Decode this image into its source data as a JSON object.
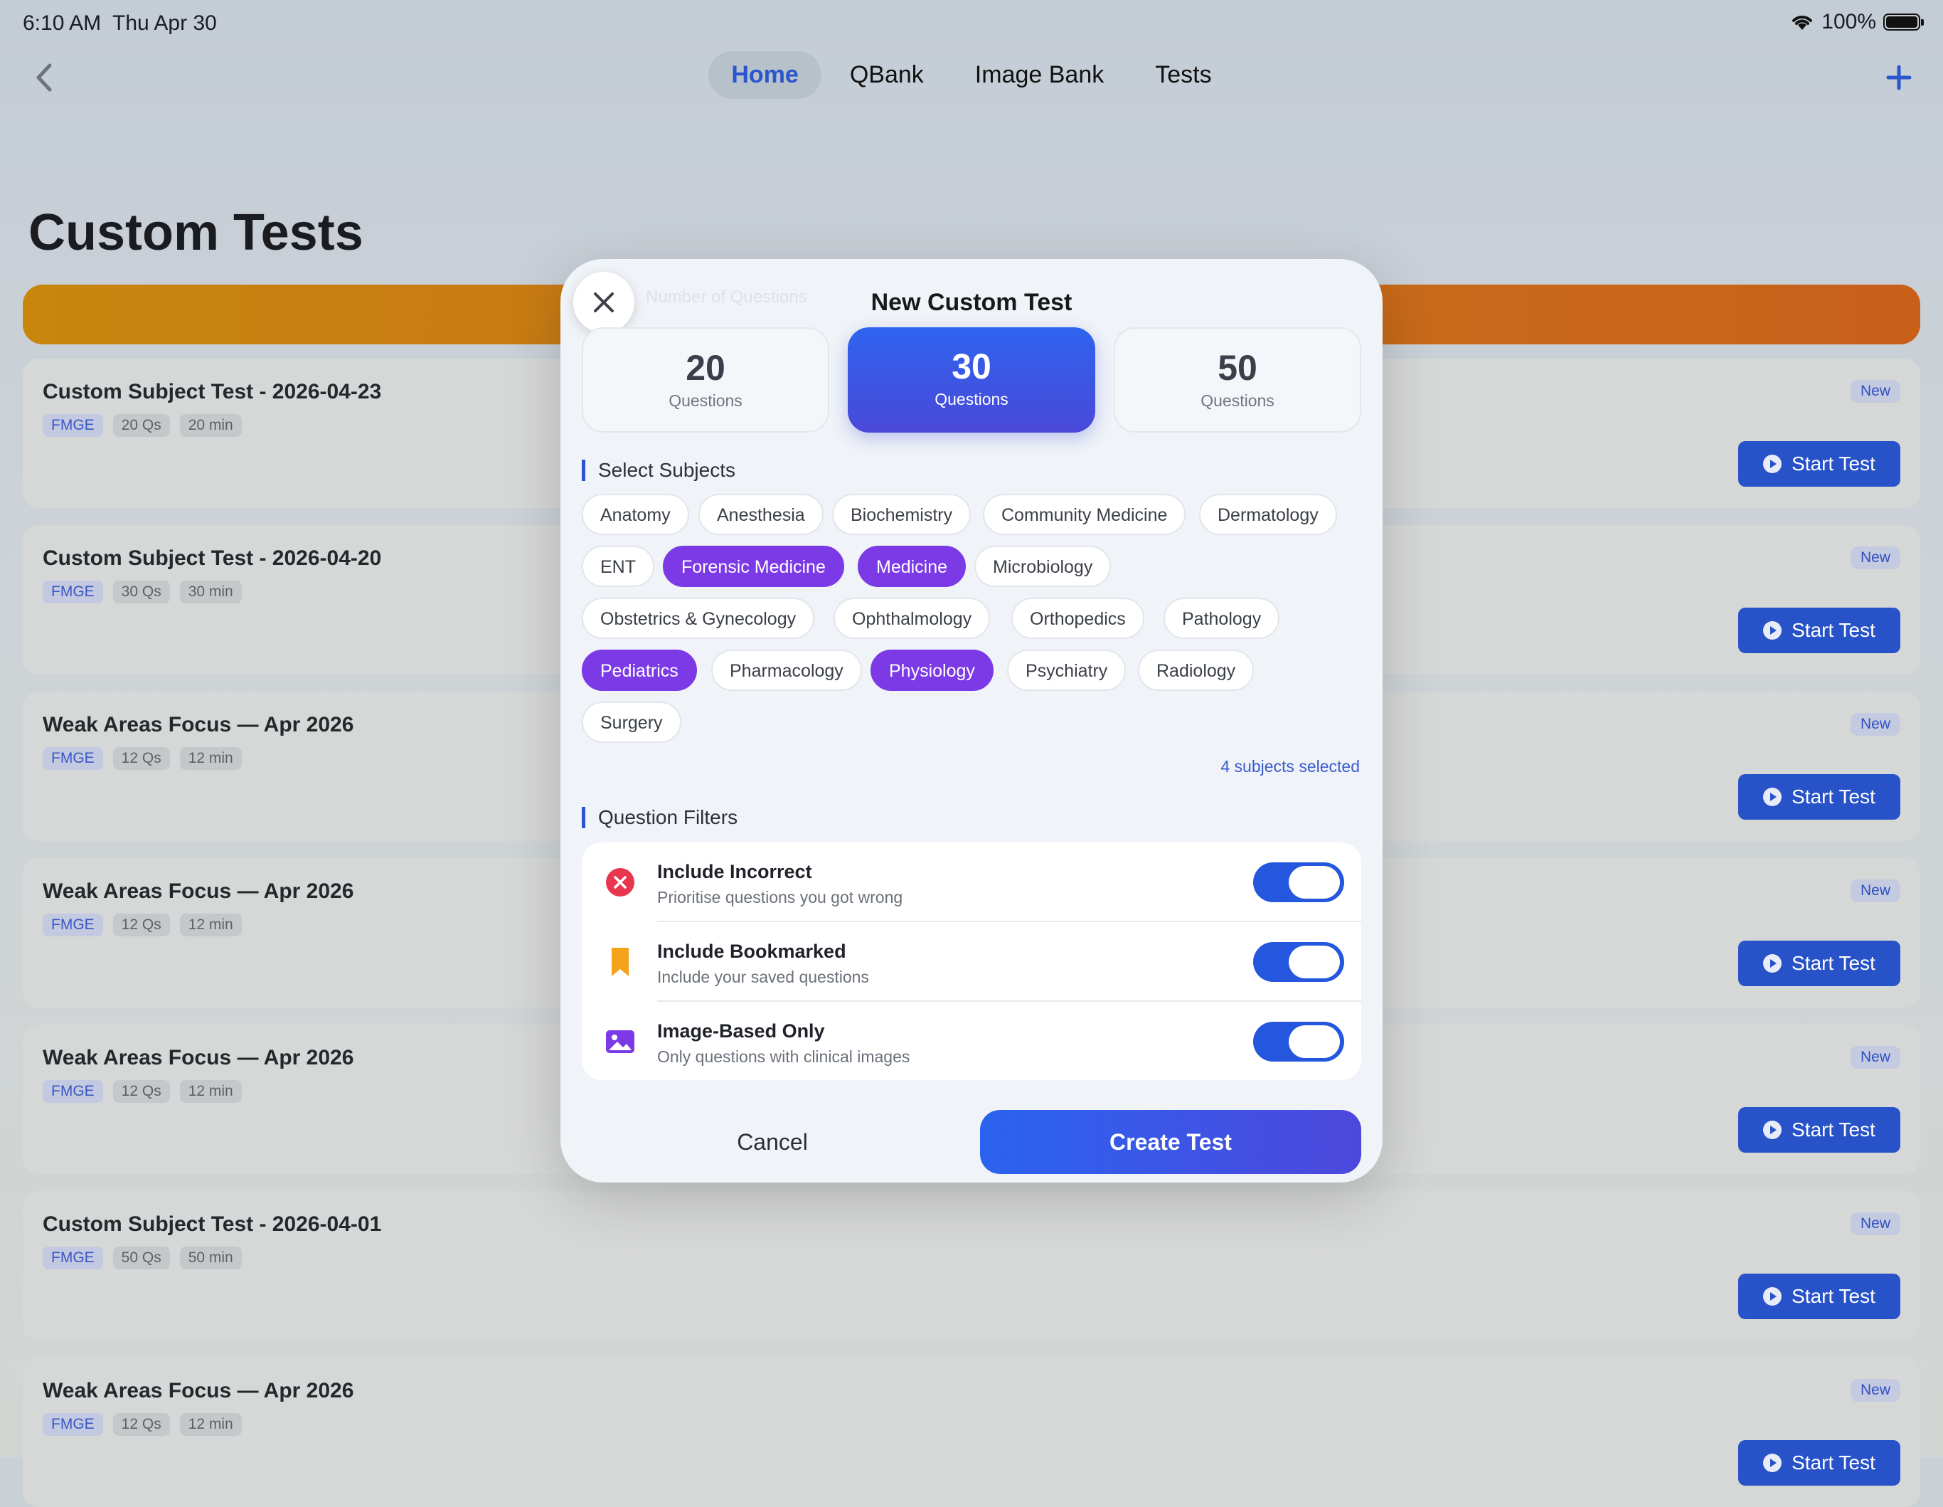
{
  "status_bar": {
    "time": "6:10 AM",
    "date": "Thu Apr 30",
    "battery": "100%"
  },
  "nav": {
    "tabs": [
      "Home",
      "QBank",
      "Image Bank",
      "Tests"
    ],
    "active_tab": "Home"
  },
  "page_title": "Custom Tests",
  "cards": [
    {
      "title": "Custom Subject Test - 2026-04-23",
      "exam": "FMGE",
      "qs": "20 Qs",
      "mins": "20 min",
      "badge": "New",
      "action": "Start Test"
    },
    {
      "title": "Custom Subject Test - 2026-04-20",
      "exam": "FMGE",
      "qs": "30 Qs",
      "mins": "30 min",
      "badge": "New",
      "action": "Start Test"
    },
    {
      "title": "Weak Areas Focus — Apr 2026",
      "exam": "FMGE",
      "qs": "12 Qs",
      "mins": "12 min",
      "badge": "New",
      "action": "Start Test"
    },
    {
      "title": "Weak Areas Focus — Apr 2026",
      "exam": "FMGE",
      "qs": "12 Qs",
      "mins": "12 min",
      "badge": "New",
      "action": "Start Test"
    },
    {
      "title": "Weak Areas Focus — Apr 2026",
      "exam": "FMGE",
      "qs": "12 Qs",
      "mins": "12 min",
      "badge": "New",
      "action": "Start Test"
    },
    {
      "title": "Custom Subject Test - 2026-04-01",
      "exam": "FMGE",
      "qs": "50 Qs",
      "mins": "50 min",
      "badge": "New",
      "action": "Start Test"
    },
    {
      "title": "Weak Areas Focus — Apr 2026",
      "exam": "FMGE",
      "qs": "12 Qs",
      "mins": "12 min",
      "badge": "New",
      "action": "Start Test"
    }
  ],
  "modal": {
    "ghost_label": "Number of Questions",
    "title": "New Custom Test",
    "question_options": [
      {
        "count": "20",
        "label": "Questions",
        "selected": false
      },
      {
        "count": "30",
        "label": "Questions",
        "selected": true
      },
      {
        "count": "50",
        "label": "Questions",
        "selected": false
      }
    ],
    "subjects_heading": "Select Subjects",
    "subjects": [
      {
        "name": "Anatomy",
        "selected": false
      },
      {
        "name": "Anesthesia",
        "selected": false
      },
      {
        "name": "Biochemistry",
        "selected": false
      },
      {
        "name": "Community Medicine",
        "selected": false
      },
      {
        "name": "Dermatology",
        "selected": false
      },
      {
        "name": "ENT",
        "selected": false
      },
      {
        "name": "Forensic Medicine",
        "selected": true
      },
      {
        "name": "Medicine",
        "selected": true
      },
      {
        "name": "Microbiology",
        "selected": false
      },
      {
        "name": "Obstetrics & Gynecology",
        "selected": false
      },
      {
        "name": "Ophthalmology",
        "selected": false
      },
      {
        "name": "Orthopedics",
        "selected": false
      },
      {
        "name": "Pathology",
        "selected": false
      },
      {
        "name": "Pediatrics",
        "selected": true
      },
      {
        "name": "Pharmacology",
        "selected": false
      },
      {
        "name": "Physiology",
        "selected": true
      },
      {
        "name": "Psychiatry",
        "selected": false
      },
      {
        "name": "Radiology",
        "selected": false
      },
      {
        "name": "Surgery",
        "selected": false
      }
    ],
    "selected_count": "4 subjects selected",
    "filters_heading": "Question Filters",
    "filters": [
      {
        "icon": "x-circle-icon",
        "title": "Include Incorrect",
        "subtitle": "Prioritise questions you got wrong",
        "on": true
      },
      {
        "icon": "bookmark-icon",
        "title": "Include Bookmarked",
        "subtitle": "Include your saved questions",
        "on": true
      },
      {
        "icon": "image-icon",
        "title": "Image-Based Only",
        "subtitle": "Only questions with clinical images",
        "on": true
      }
    ],
    "cancel_label": "Cancel",
    "create_label": "Create Test"
  },
  "colors": {
    "accent": "#2a55cf",
    "chip_selected": "#7c3ae6",
    "banner": "#c8760f"
  }
}
